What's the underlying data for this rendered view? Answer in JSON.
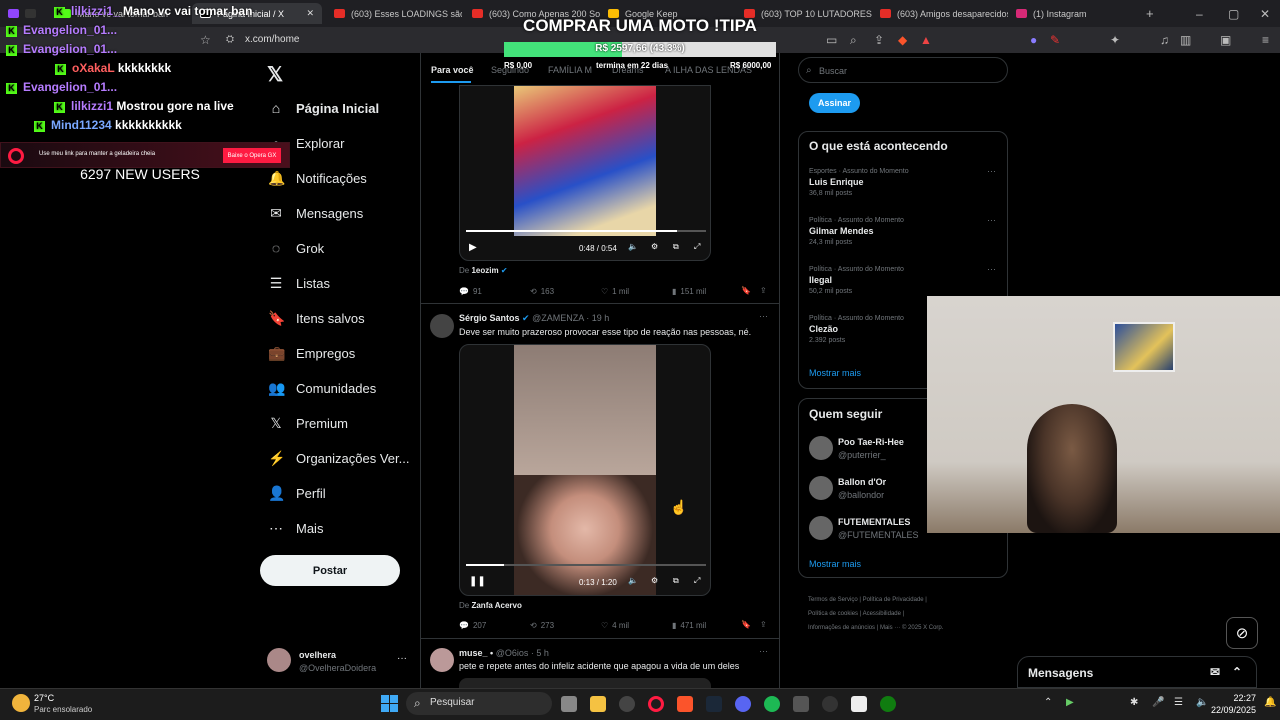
{
  "tabs": [
    {
      "label": "Mano vc vai tomar ban"
    },
    {
      "label": "Página Inicial / X"
    },
    {
      "label": "(603) Esses LOADINGS são ES"
    },
    {
      "label": "(603) Como Apenas 200 Sold"
    },
    {
      "label": "Google Keep"
    },
    {
      "label": "(603) TOP 10 LUTADORES M"
    },
    {
      "label": "(603) Amigos desaparecidos"
    },
    {
      "label": "(1) Instagram"
    }
  ],
  "address": {
    "url": "x.com/home"
  },
  "overlay": {
    "goal_title": "COMPRAR UMA MOTO !TIPA",
    "goal_amount": "R$ 2597,66 (43.3%)",
    "goal_progress": 0.433,
    "goal_min": "R$ 0,00",
    "goal_deadline": "termina em 22 dias",
    "goal_max": "R$ 6000,00",
    "new_users": "6297 NEW USERS",
    "opera_text": "Use meu link para manter a geladeira cheia",
    "opera_btn": "Baixe o Opera GX",
    "chat": [
      {
        "user": "lilkizzi1_",
        "msg": "Mano vc vai tomar ban",
        "color": "#b67cff"
      },
      {
        "user": "Evangelion_01...",
        "msg": "",
        "color": "#b67cff"
      },
      {
        "user": "Evangelion_01...",
        "msg": "",
        "color": "#b67cff"
      },
      {
        "user": "oXakaL",
        "msg": "kkkkkkkk",
        "color": "#ff5f5f"
      },
      {
        "user": "Evangelion_01...",
        "msg": "",
        "color": "#b67cff"
      },
      {
        "user": "lilkizzi1",
        "msg": "Mostrou gore na live",
        "color": "#b67cff"
      },
      {
        "user": "Mind11234",
        "msg": "kkkkkkkkkk",
        "color": "#7aa8ff"
      }
    ]
  },
  "nav": {
    "items": [
      {
        "label": "Página Inicial",
        "icon": "home-icon",
        "glyph": "⌂"
      },
      {
        "label": "Explorar",
        "icon": "search-icon",
        "glyph": "⌕"
      },
      {
        "label": "Notificações",
        "icon": "bell-icon",
        "glyph": "🔔"
      },
      {
        "label": "Mensagens",
        "icon": "mail-icon",
        "glyph": "✉"
      },
      {
        "label": "Grok",
        "icon": "grok-icon",
        "glyph": "◌"
      },
      {
        "label": "Listas",
        "icon": "list-icon",
        "glyph": "☰"
      },
      {
        "label": "Itens salvos",
        "icon": "bookmark-icon",
        "glyph": "🔖"
      },
      {
        "label": "Empregos",
        "icon": "briefcase-icon",
        "glyph": "💼"
      },
      {
        "label": "Comunidades",
        "icon": "people-icon",
        "glyph": "👥"
      },
      {
        "label": "Premium",
        "icon": "x-logo-icon",
        "glyph": "𝕏"
      },
      {
        "label": "Organizações Ver...",
        "icon": "lightning-icon",
        "glyph": "⚡"
      },
      {
        "label": "Perfil",
        "icon": "person-icon",
        "glyph": "👤"
      },
      {
        "label": "Mais",
        "icon": "more-circle-icon",
        "glyph": "⋯"
      }
    ],
    "post_label": "Postar",
    "account_name": "ovelhera",
    "account_handle": "@OvelheraDoidera"
  },
  "timeline": {
    "tabs": [
      "Para você",
      "Seguindo",
      "FAMÍLIA M",
      "Dreams",
      "A ILHA DAS LENDAS"
    ],
    "post1": {
      "video_time": "0:48 / 0:54",
      "source_prefix": "De",
      "source": "1eozim",
      "replies": "91",
      "reposts": "163",
      "likes": "1 mil",
      "views": "151 mil"
    },
    "post2": {
      "name": "Sérgio Santos",
      "handle": "@ZAMENZA",
      "time": "· 19 h",
      "text": "Deve ser muito prazeroso provocar esse tipo de reação nas pessoas, né.",
      "video_time": "0:13 / 1:20",
      "video_progress": 0.16,
      "source_prefix": "De",
      "source": "Zanfa Acervo",
      "replies": "207",
      "reposts": "273",
      "likes": "4 mil",
      "views": "471 mil"
    },
    "post3": {
      "name": "muse_ •",
      "handle": "@O6ios",
      "time": "· 5 h",
      "text": "pete e repete antes do infeliz acidente que apagou a vida de um deles"
    }
  },
  "right": {
    "search_placeholder": "Buscar",
    "subscribe": "Assinar",
    "trends_title": "O que está acontecendo",
    "trends": [
      {
        "category": "Esportes · Assunto do Momento",
        "name": "Luis Enrique",
        "posts": "36,8 mil posts"
      },
      {
        "category": "Política · Assunto do Momento",
        "name": "Gilmar Mendes",
        "posts": "24,3 mil posts"
      },
      {
        "category": "Política · Assunto do Momento",
        "name": "Ilegal",
        "posts": "50,2 mil posts"
      },
      {
        "category": "Política · Assunto do Momento",
        "name": "Clezão",
        "posts": "2.392 posts"
      }
    ],
    "show_more": "Mostrar mais",
    "follow_title": "Quem seguir",
    "follow": [
      {
        "name": "Poo Tae-Ri-Hee",
        "handle": "@puterrier_"
      },
      {
        "name": "Ballon d'Or",
        "handle": "@ballondor"
      },
      {
        "name": "FUTEMENTALES",
        "handle": "@FUTEMENTALES"
      }
    ],
    "follow_more": "Mostrar mais",
    "footer": [
      "Termos de Serviço",
      "Política de Privacidade",
      "Política de cookies",
      "Acessibilidade",
      "Informações de anúncios",
      "Mais ···",
      "© 2025 X Corp."
    ],
    "messages": "Mensagens"
  },
  "taskbar": {
    "weather_temp": "27°C",
    "weather_desc": "Parc ensolarado",
    "search": "Pesquisar",
    "time": "22:27",
    "date": "22/09/2025"
  },
  "colors": {
    "accent": "#1d9bf0",
    "bg": "#000000",
    "text": "#e7e9ea",
    "muted": "#71767b"
  }
}
